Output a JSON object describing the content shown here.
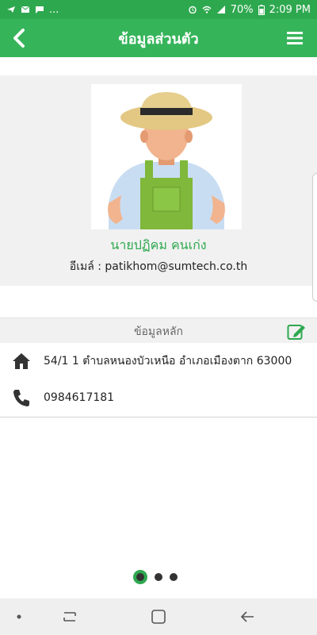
{
  "status_bar": {
    "overflow": "...",
    "battery": "70%",
    "time": "2:09 PM",
    "icons": [
      "telegram-icon",
      "mail-icon",
      "message-icon",
      "alarm-icon",
      "wifi-icon",
      "signal-icon",
      "battery-icon"
    ]
  },
  "header": {
    "title": "ข้อมูลส่วนตัว",
    "back_icon": "chevron-left-icon",
    "menu_icon": "hamburger-menu-icon"
  },
  "profile": {
    "avatar": "farmer-avatar",
    "name": "นายปฏิคม คนเก่ง",
    "email_label": "อีเมล์ : patikhom@sumtech.co.th"
  },
  "main_info": {
    "title": "ข้อมูลหลัก",
    "edit_icon": "edit-icon",
    "address": "54/1 1 ตำบลหนองบัวเหนือ อำเภอเมืองตาก 63000",
    "phone": "0984617181"
  },
  "pager": {
    "count": 3,
    "active_index": 0
  },
  "colors": {
    "accent": "#36b45a",
    "status_bar": "#2ea84f",
    "name_text": "#2ea84f"
  }
}
